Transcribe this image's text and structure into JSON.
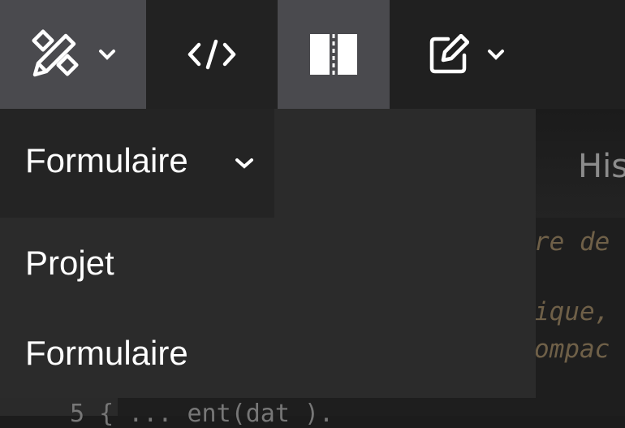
{
  "toolbar": {
    "buttons": [
      {
        "icon": "pencil-ruler-icon",
        "has_dropdown": true
      },
      {
        "icon": "code-icon",
        "has_dropdown": false
      },
      {
        "icon": "split-view-icon",
        "has_dropdown": false,
        "active": true
      },
      {
        "icon": "edit-icon",
        "has_dropdown": true
      }
    ]
  },
  "history": {
    "label": "His"
  },
  "background": {
    "line1": "re de",
    "line2": "ique,",
    "line3": "ompac",
    "code": "5   { ... ent(dat )."
  },
  "dropdown": {
    "selected": "Formulaire",
    "items": [
      "Projet",
      "Formulaire"
    ]
  }
}
